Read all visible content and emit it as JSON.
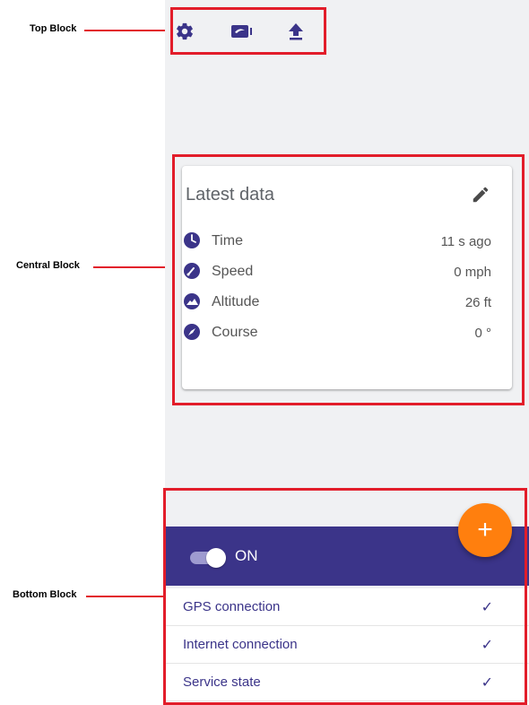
{
  "annotations": {
    "top": "Top Block",
    "central": "Central Block",
    "bottom": "Bottom Block"
  },
  "toolbar": {
    "icons": [
      "gear-icon",
      "camera-icon",
      "upload-icon"
    ]
  },
  "card": {
    "title": "Latest data",
    "rows": [
      {
        "label": "Time",
        "value": "11 s ago",
        "icon": "clock-icon"
      },
      {
        "label": "Speed",
        "value": "0 mph",
        "icon": "speedometer-icon"
      },
      {
        "label": "Altitude",
        "value": "26 ft",
        "icon": "mountain-icon"
      },
      {
        "label": "Course",
        "value": "0 °",
        "icon": "compass-icon"
      }
    ]
  },
  "fab": {
    "label": "+"
  },
  "toggle": {
    "label": "ON",
    "state": "on"
  },
  "status": [
    {
      "label": "GPS connection",
      "check": "✓"
    },
    {
      "label": "Internet connection",
      "check": "✓"
    },
    {
      "label": "Service state",
      "check": "✓"
    }
  ],
  "colors": {
    "primary": "#3b3489",
    "accent": "#ff7f0e",
    "annotation": "#e21d2a",
    "app_background": "#f0f1f3"
  }
}
